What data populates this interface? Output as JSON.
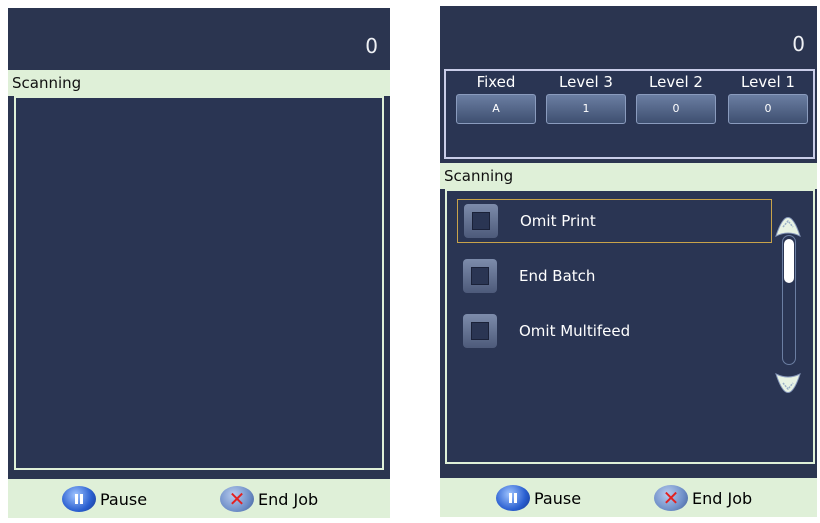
{
  "left_panel": {
    "counter": "0",
    "title": "Scanning",
    "footer": {
      "pause_label": "Pause",
      "end_job_label": "End Job"
    }
  },
  "right_panel": {
    "counter": "0",
    "levels": [
      {
        "name": "Fixed",
        "value": "A"
      },
      {
        "name": "Level 3",
        "value": "1"
      },
      {
        "name": "Level 2",
        "value": "0"
      },
      {
        "name": "Level 1",
        "value": "0"
      }
    ],
    "title": "Scanning",
    "options": [
      {
        "label": "Omit Print",
        "selected": true
      },
      {
        "label": "End Batch",
        "selected": false
      },
      {
        "label": "Omit Multifeed",
        "selected": false
      }
    ],
    "footer": {
      "pause_label": "Pause",
      "end_job_label": "End Job"
    }
  },
  "colors": {
    "panel_bg": "#2b3550",
    "header_bar": "#dff0d8",
    "selection_border": "#c8a34a"
  }
}
